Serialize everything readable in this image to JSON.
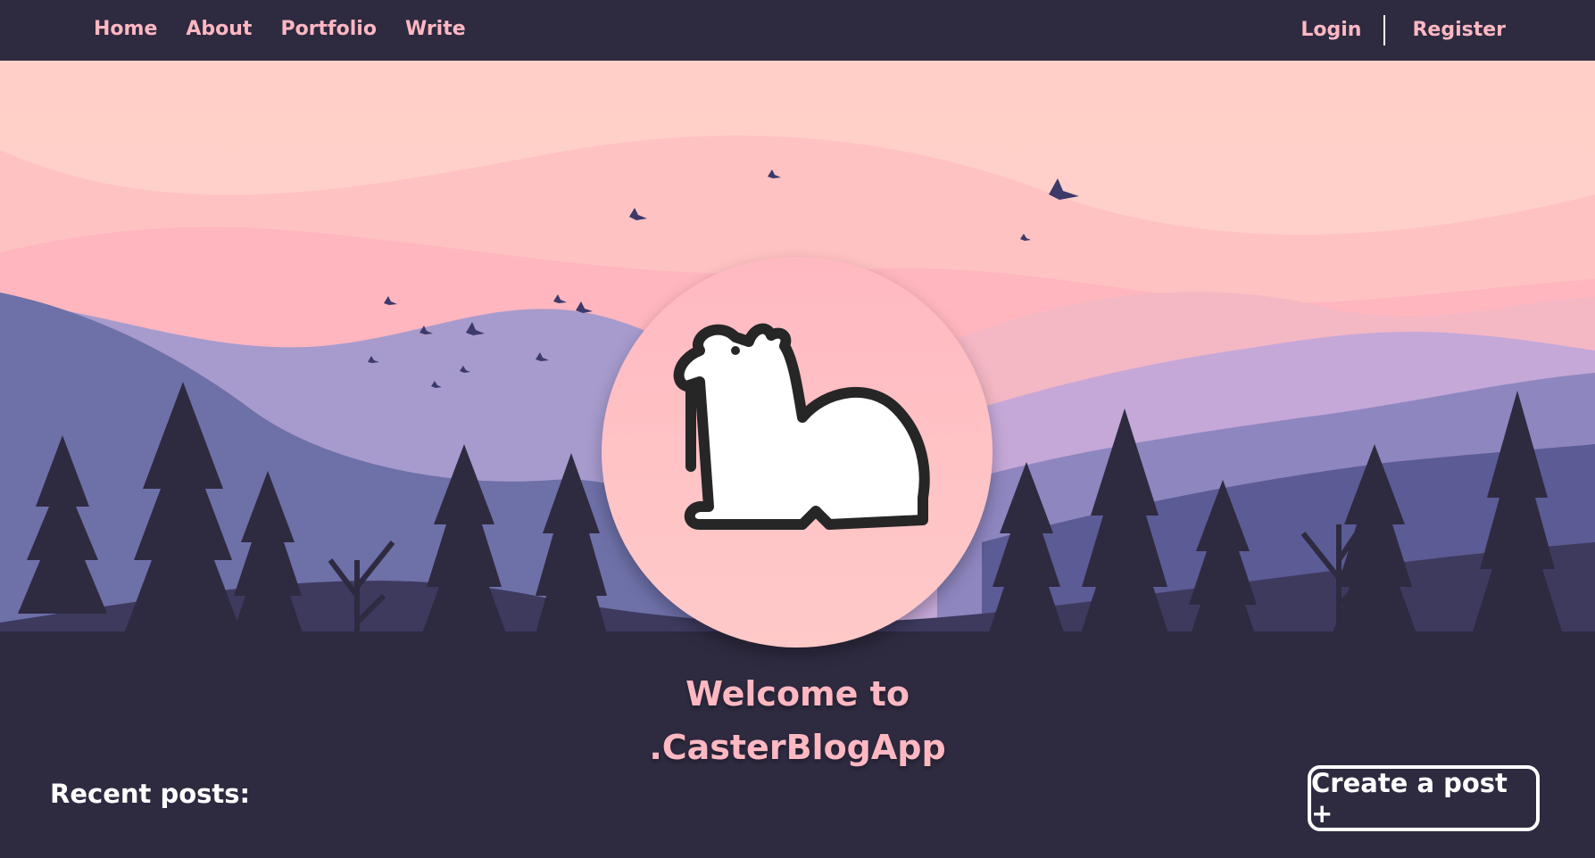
{
  "nav": {
    "left": [
      {
        "label": "Home"
      },
      {
        "label": "About"
      },
      {
        "label": "Portfolio"
      },
      {
        "label": "Write"
      }
    ],
    "right": [
      {
        "label": "Login"
      },
      {
        "label": "Register"
      }
    ]
  },
  "hero": {
    "welcome_line1": "Welcome to",
    "welcome_line2": ".CasterBlogApp",
    "logo_icon": "camel-icon"
  },
  "posts": {
    "heading": "Recent posts:",
    "create_button": "Create a post +"
  },
  "colors": {
    "background": "#2e2a40",
    "accent_pink": "#ffb8c2",
    "sky": "#ffcfc8",
    "hills_lavender": "#a79bcd",
    "hills_blue": "#6e70a8",
    "white": "#ffffff"
  }
}
